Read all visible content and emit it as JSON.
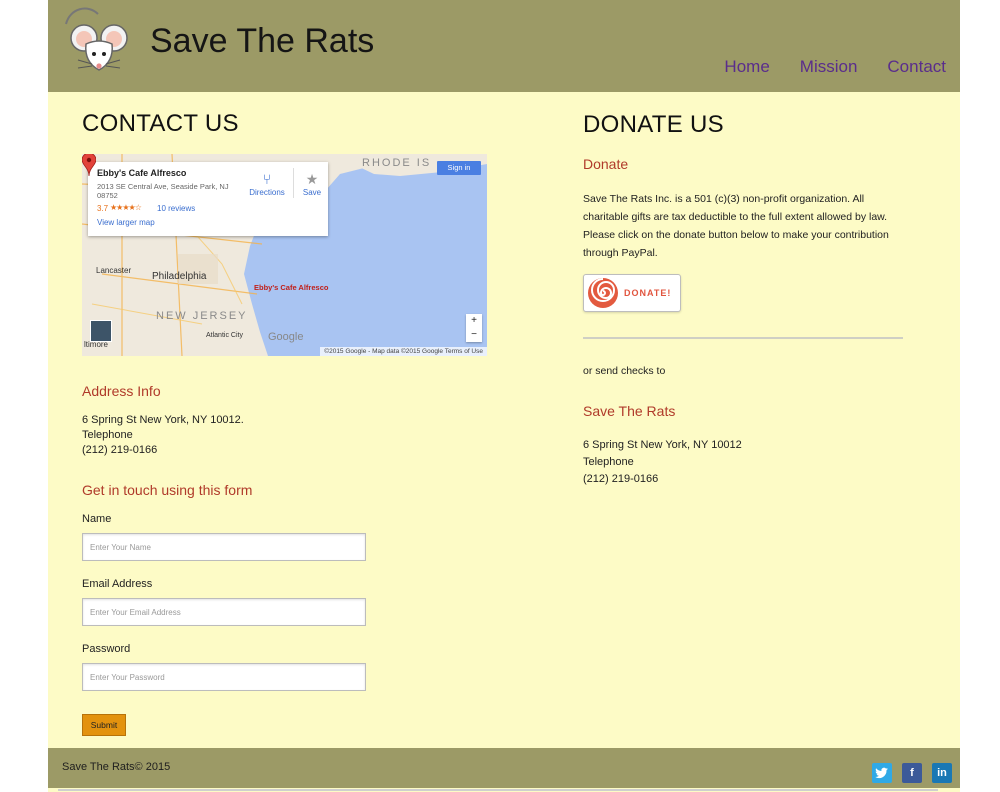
{
  "site": {
    "title": "Save The Rats"
  },
  "nav": {
    "items": [
      "Home",
      "Mission",
      "Contact"
    ]
  },
  "contact": {
    "heading": "CONTACT US",
    "map": {
      "place_name": "Ebby's Cafe Alfresco",
      "place_address": "2013 SE Central Ave, Seaside Park, NJ 08752",
      "rating": "3.7",
      "stars": "★★★★☆",
      "reviews": "10 reviews",
      "view_larger": "View larger map",
      "directions": "Directions",
      "save": "Save",
      "sign_in": "Sign in",
      "pin_label": "Ebby's Cafe Alfresco",
      "labels": {
        "rhode_island": "RHODE IS",
        "philadelphia": "Philadelphia",
        "new_jersey": "NEW JERSEY",
        "lancaster": "Lancaster",
        "atlantic_city": "Atlantic City",
        "baltimore": "ltimore"
      },
      "google": "Google",
      "footer": "©2015 Google - Map data ©2015 Google   Terms of Use",
      "zoom_in": "+",
      "zoom_out": "−"
    },
    "address_heading": "Address Info",
    "address_lines": [
      "6 Spring St New York, NY 10012.",
      "Telephone",
      "(212) 219-0166"
    ],
    "form_heading": "Get in touch using this form",
    "fields": [
      {
        "label": "Name",
        "placeholder": "Enter Your Name"
      },
      {
        "label": "Email Address",
        "placeholder": "Enter Your Email Address"
      },
      {
        "label": "Password",
        "placeholder": "Enter Your Password"
      }
    ],
    "submit": "Submit"
  },
  "donate": {
    "heading": "DONATE US",
    "subheading": "Donate",
    "text": "Save The Rats Inc. is a 501 (c)(3) non-profit organization. All charitable gifts are tax deductible to the full extent allowed by law. Please click on the donate button below to make your contribution through PayPal.",
    "button": "DONATE!",
    "checks_text": "or send checks to",
    "org_heading": "Save The Rats",
    "org_lines": [
      "6 Spring St New York, NY 10012",
      "Telephone",
      "(212) 219-0166"
    ]
  },
  "footer": {
    "copyright": "Save The Rats© 2015",
    "social": [
      {
        "name": "twitter",
        "glyph": "🐦"
      },
      {
        "name": "facebook",
        "glyph": "f"
      },
      {
        "name": "linkedin",
        "glyph": "in"
      }
    ]
  },
  "colors": {
    "header_bg": "#9c9a66",
    "page_bg": "#fdfbc6",
    "nav_link": "#5a2d8c",
    "accent_red": "#b03a2a",
    "submit_bg": "#e3920e"
  }
}
